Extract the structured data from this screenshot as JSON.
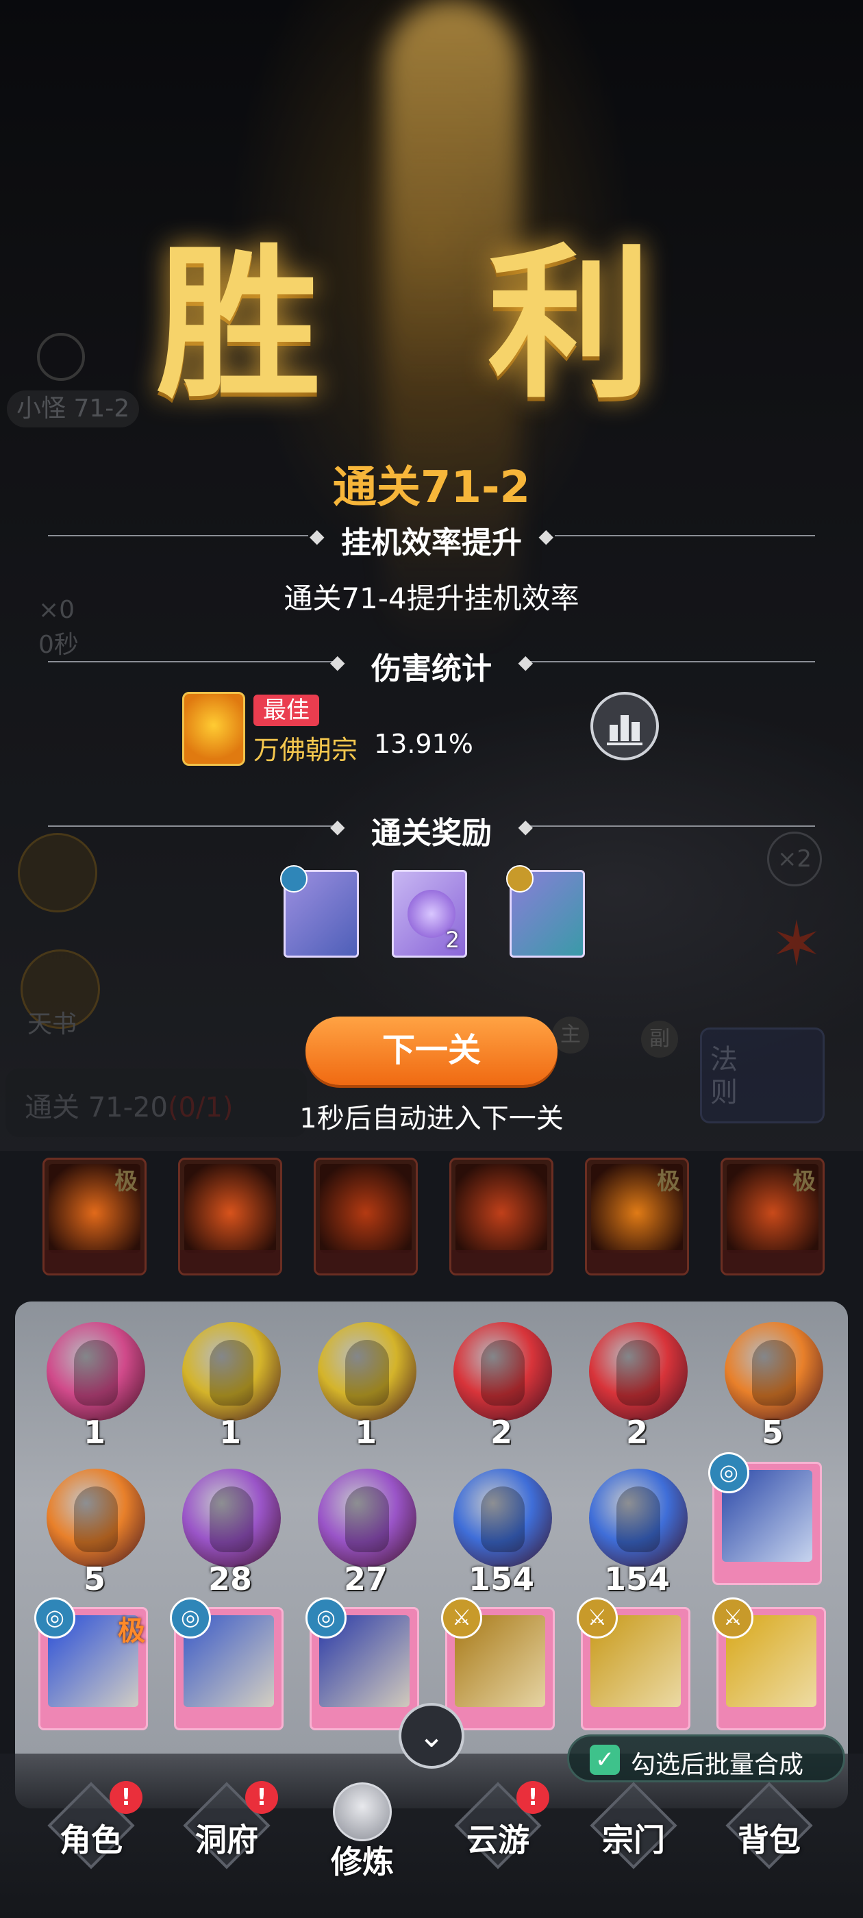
{
  "result": {
    "title": "胜 利",
    "stage_cleared": "通关71-2"
  },
  "sections": {
    "efficiency_title": "挂机效率提升",
    "efficiency_text": "通关71-4提升挂机效率",
    "damage_title": "伤害统计",
    "reward_title": "通关奖励"
  },
  "damage": {
    "best_label": "最佳",
    "name": "万佛朝宗",
    "percent": "13.91%"
  },
  "rewards": [
    {
      "icon": "gauntlet-card-icon",
      "count": ""
    },
    {
      "icon": "spirit-orb-icon",
      "count": "2"
    },
    {
      "icon": "ice-orb-card-icon",
      "count": ""
    }
  ],
  "next_button": "下一关",
  "auto_text": "1秒后自动进入下一关",
  "background_hud": {
    "stage_label": "小怪 71-2",
    "kills": "×0",
    "time": "0秒",
    "book_label": "天书",
    "multiplier": "×2",
    "quest_text": "通关 71-20",
    "quest_progress": "(0/1)",
    "law_label": "法则",
    "main_tag": "主",
    "sub_tag": "副"
  },
  "skill_cards": [
    {
      "tag": "极",
      "color": "#e26a1a"
    },
    {
      "tag": "",
      "color": "#d8531c"
    },
    {
      "tag": "",
      "color": "#b43a12"
    },
    {
      "tag": "",
      "color": "#c0401a"
    },
    {
      "tag": "极",
      "color": "#e07b16"
    },
    {
      "tag": "极",
      "color": "#c94a1a"
    }
  ],
  "orbs_row1": [
    {
      "count": "1",
      "color": "#d04a8a"
    },
    {
      "count": "1",
      "color": "#d4b42a"
    },
    {
      "count": "1",
      "color": "#d4b42a"
    },
    {
      "count": "2",
      "color": "#d8343a"
    },
    {
      "count": "2",
      "color": "#d8343a"
    },
    {
      "count": "5",
      "color": "#e8802a"
    }
  ],
  "orbs_row2": [
    {
      "count": "5",
      "color": "#e8802a"
    },
    {
      "count": "28",
      "color": "#9a55c8"
    },
    {
      "count": "27",
      "color": "#9a55c8"
    },
    {
      "count": "154",
      "color": "#3f6ed8"
    },
    {
      "count": "154",
      "color": "#3f6ed8"
    }
  ],
  "cards_row": [
    {
      "badge": "water",
      "tag": "极",
      "art": "#2a4fd8"
    },
    {
      "badge": "water",
      "tag": "",
      "art": "#3a5ac8"
    },
    {
      "badge": "water",
      "tag": "",
      "art": "#2a3aa8"
    },
    {
      "badge": "metal",
      "tag": "",
      "art": "#a87a18"
    },
    {
      "badge": "metal",
      "tag": "",
      "art": "#c89a1a"
    },
    {
      "badge": "metal",
      "tag": "",
      "art": "#d8a81a"
    }
  ],
  "batch_merge_label": "勾选后批量合成",
  "nav": [
    {
      "label": "角色",
      "alert": "!"
    },
    {
      "label": "洞府",
      "alert": "!"
    },
    {
      "label": "修炼",
      "alert": ""
    },
    {
      "label": "云游",
      "alert": "!"
    },
    {
      "label": "宗门",
      "alert": ""
    },
    {
      "label": "背包",
      "alert": ""
    }
  ]
}
